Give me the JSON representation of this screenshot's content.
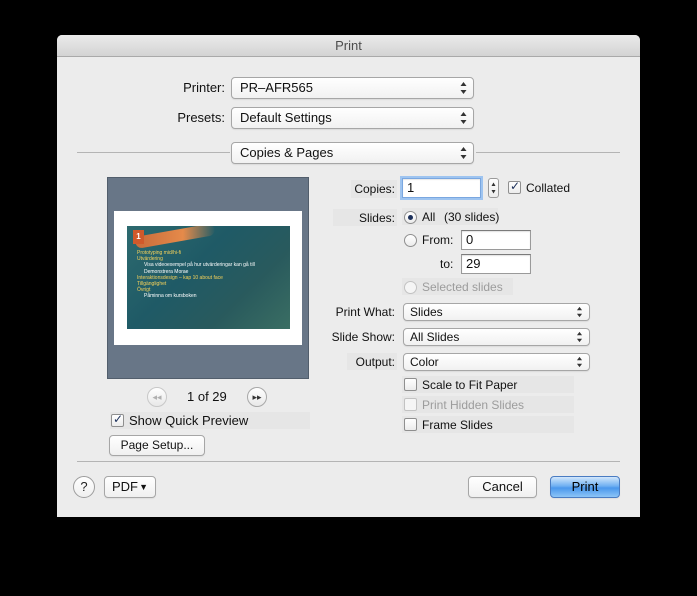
{
  "window": {
    "title": "Print"
  },
  "printer": {
    "label": "Printer:",
    "value": "PR–AFR565"
  },
  "presets": {
    "label": "Presets:",
    "value": "Default Settings"
  },
  "section": {
    "value": "Copies & Pages"
  },
  "preview": {
    "page_indicator": "1 of 29",
    "slide_badge": "1",
    "slide_lines": [
      {
        "text": "Prototyping mid/hi-fi",
        "sub": false
      },
      {
        "text": "Utvärdering",
        "sub": false
      },
      {
        "text": "Visa videoexempel på hur utvärderingar kan gå till",
        "sub": true
      },
      {
        "text": "Demonstrera Morae",
        "sub": true
      },
      {
        "text": "Interaktionsdesign – kap 10 about face",
        "sub": false
      },
      {
        "text": "Tillgänglighet",
        "sub": false
      },
      {
        "text": "Övrigt",
        "sub": false
      },
      {
        "text": "Påminna om kursboken",
        "sub": true
      }
    ],
    "prev_icon": "chevron-left-icon",
    "next_icon": "chevron-right-icon"
  },
  "show_quick_preview": {
    "label": "Show Quick Preview",
    "checked": true
  },
  "page_setup": {
    "label": "Page Setup..."
  },
  "copies": {
    "label": "Copies:",
    "value": "1",
    "collated_label": "Collated",
    "collated": true
  },
  "slides": {
    "label": "Slides:",
    "all_label": "All",
    "all_count": "(30 slides)",
    "from_label": "From:",
    "from_value": "0",
    "to_label": "to:",
    "to_value": "29",
    "selected_label": "Selected slides"
  },
  "print_what": {
    "label": "Print What:",
    "value": "Slides"
  },
  "slide_show": {
    "label": "Slide Show:",
    "value": "All Slides"
  },
  "output": {
    "label": "Output:",
    "value": "Color"
  },
  "options": {
    "scale_to_fit": "Scale to Fit Paper",
    "print_hidden": "Print Hidden Slides",
    "frame_slides": "Frame Slides"
  },
  "footer": {
    "help_label": "?",
    "pdf_label": "PDF",
    "cancel_label": "Cancel",
    "print_label": "Print"
  },
  "colors": {
    "accent": "#4a97ec",
    "preview_bg": "#687687"
  }
}
